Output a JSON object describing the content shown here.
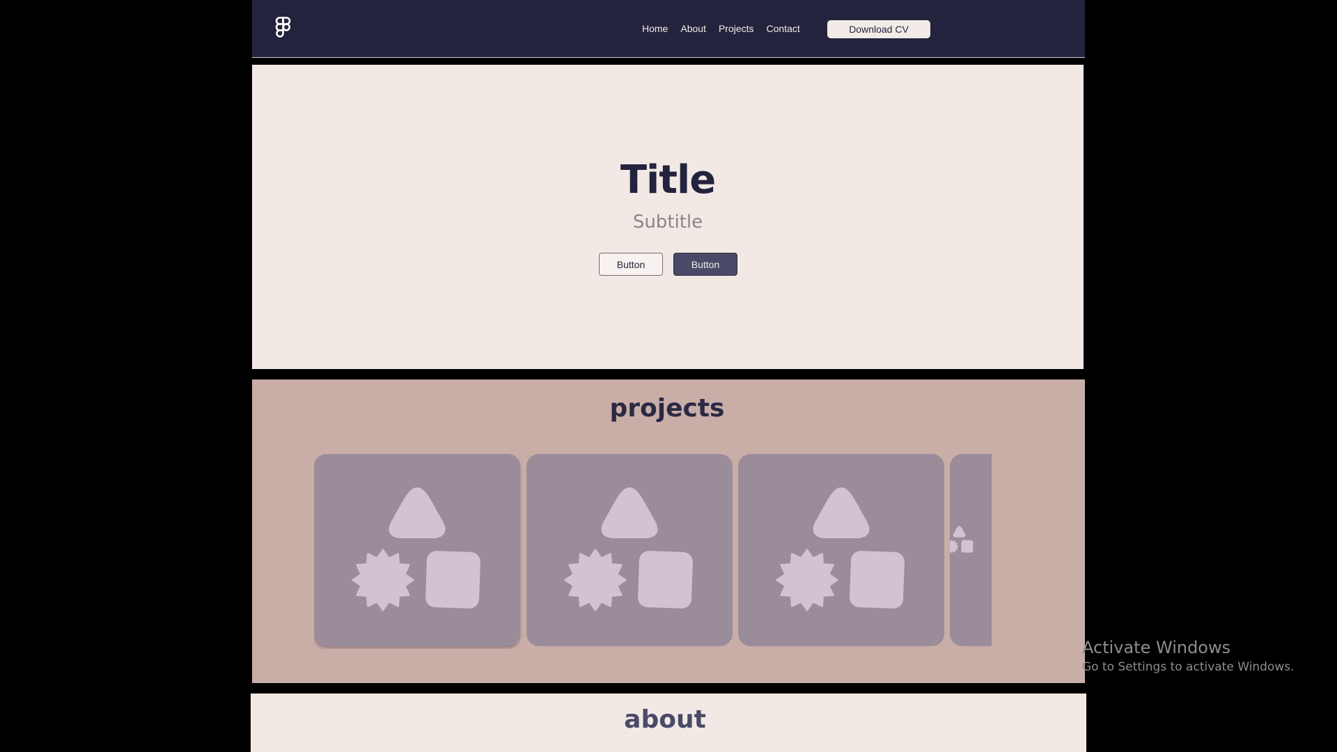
{
  "nav": {
    "logo_icon": "figma-logo-icon",
    "links": [
      "Home",
      "About",
      "Projects",
      "Contact"
    ],
    "cv_button": "Download CV"
  },
  "hero": {
    "title": "Title",
    "subtitle": "Subtitle",
    "button_secondary": "Button",
    "button_primary": "Button"
  },
  "projects": {
    "heading": "projects",
    "card_icon": "shapes-placeholder-icon",
    "cards": 4
  },
  "about": {
    "heading": "about"
  },
  "watermark": {
    "line1": "Activate Windows",
    "line2": "Go to Settings to activate Windows."
  },
  "colors": {
    "nav_bg": "#24233d",
    "hero_bg": "#f2e9e5",
    "projects_bg": "#c9ada7",
    "card_bg": "#9a8c98",
    "card_shape": "#d2c3d2",
    "primary_button": "#4a4a68"
  }
}
